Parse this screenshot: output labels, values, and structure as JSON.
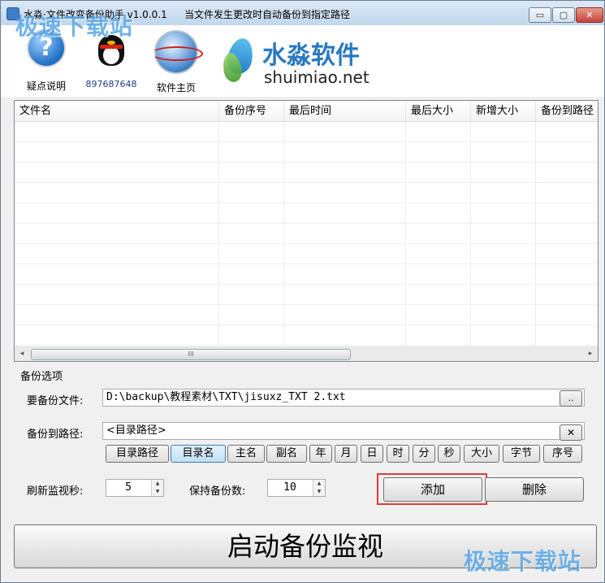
{
  "window": {
    "title": "水淼·文件改变备份助手 v1.0.0.1",
    "description": "当文件发生更改时自动备份到指定路径",
    "controls": {
      "minimize": "▭",
      "maximize": "▢",
      "close": "✕"
    }
  },
  "watermark": {
    "top_left": "极速下载站",
    "bottom_right": "极速下载站"
  },
  "toolbar": {
    "items": [
      {
        "label": "疑点说明",
        "icon": "help-icon"
      },
      {
        "label": "897687648",
        "icon": "qq-penguin-icon"
      },
      {
        "label": "软件主页",
        "icon": "globe-icon"
      }
    ],
    "brand": {
      "name_cn": "水淼软件",
      "name_en": "shuimiao.net",
      "color": "#2a79c0"
    }
  },
  "listview": {
    "columns": [
      "文件名",
      "备份序号",
      "最后时间",
      "最后大小",
      "新增大小",
      "备份到路径"
    ],
    "rows": [],
    "scroll_grip": "III",
    "scroll_left": "◂",
    "scroll_right": "▸"
  },
  "options": {
    "section_title": "备份选项",
    "source_label": "要备份文件:",
    "source_value": "D:\\backup\\教程素材\\TXT\\jisuxz_TXT 2.txt",
    "browse_label": "..",
    "dest_label": "备份到路径:",
    "dest_value": "<目录路径>",
    "clear_label": "✕",
    "tokens": [
      "目录路径",
      "目录名",
      "主名",
      "副名",
      "年",
      "月",
      "日",
      "时",
      "分",
      "秒",
      "大小",
      "字节",
      "序号"
    ],
    "active_token": "目录名",
    "refresh_label": "刷新监视秒:",
    "refresh_value": "5",
    "keep_label": "保持备份数:",
    "keep_value": "10",
    "spin_up": "▲",
    "spin_down": "▼",
    "add_label": "添加",
    "delete_label": "删除",
    "highlight_color": "#e23a3a"
  },
  "start_label": "启动备份监视"
}
